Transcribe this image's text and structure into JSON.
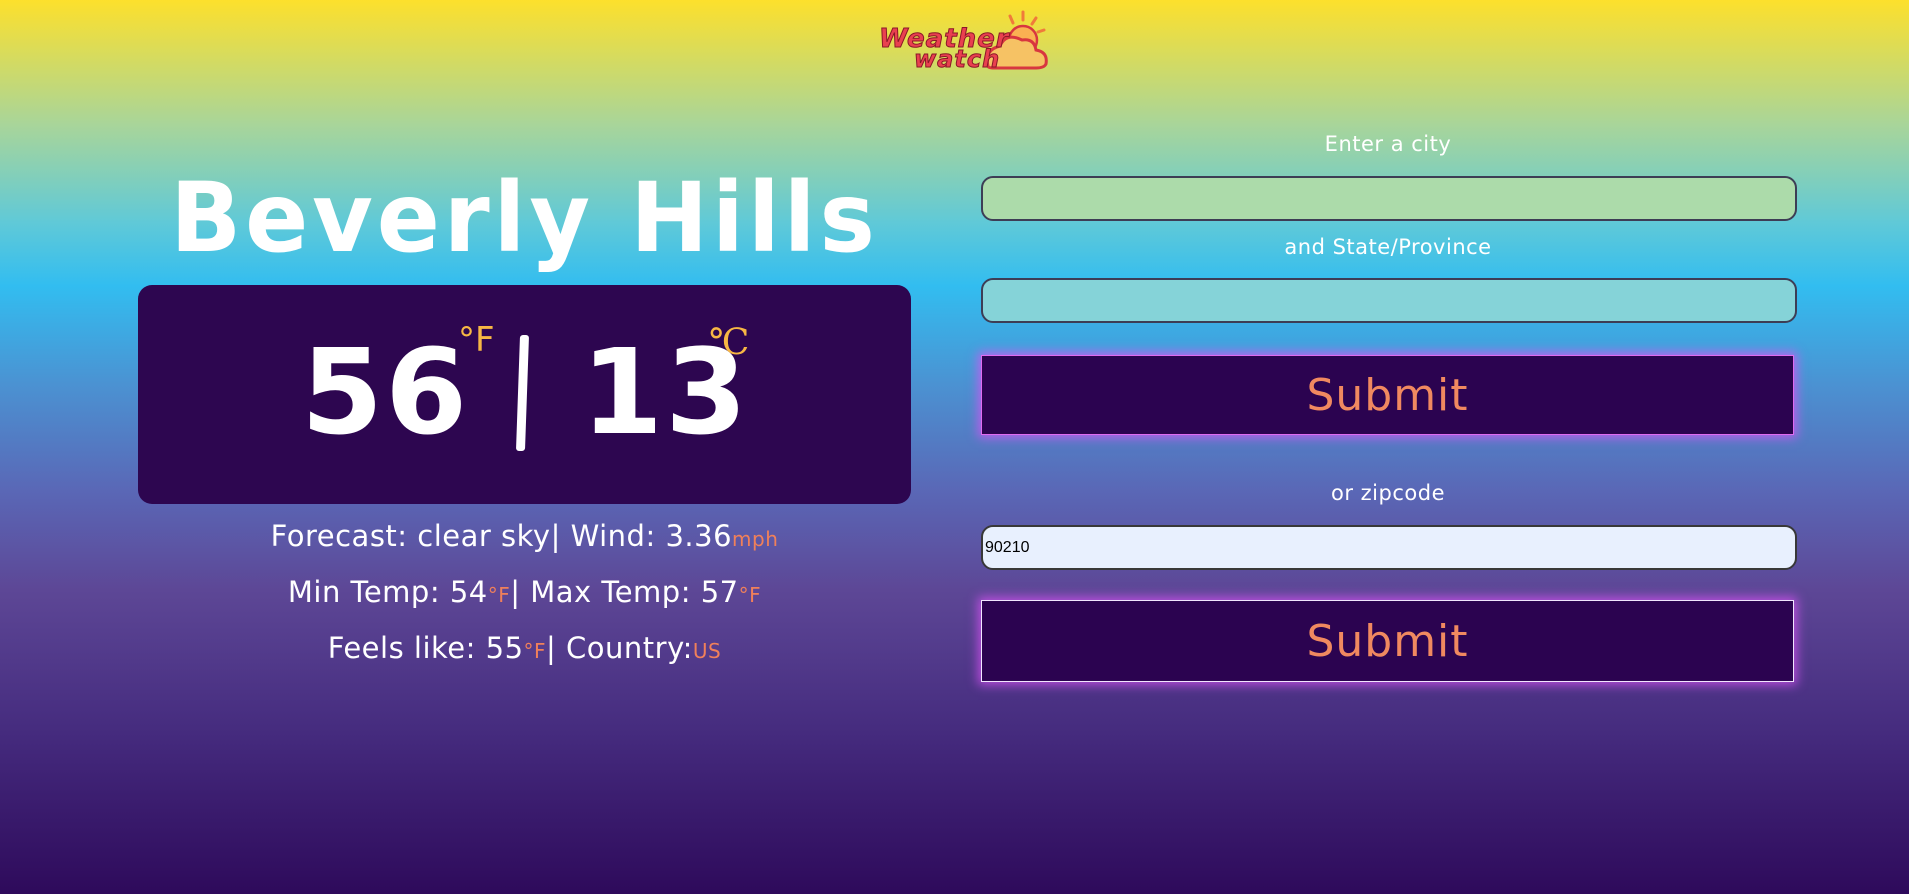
{
  "logo": {
    "line1": "Weather",
    "line2": "watch"
  },
  "weather": {
    "city": "Beverly Hills",
    "temp_f": "56",
    "unit_f": "°F",
    "divider": "|",
    "temp_c": "13",
    "unit_c": "℃",
    "forecast_label": "Forecast: ",
    "forecast_value": "clear sky",
    "wind_label": "| Wind: ",
    "wind_value": "3.36",
    "wind_unit": "mph",
    "min_label": "Min Temp: ",
    "min_value": "54",
    "min_unit": "°F",
    "max_label": "| Max Temp: ",
    "max_value": "57",
    "max_unit": "°F",
    "feels_label": "Feels like: ",
    "feels_value": "55",
    "feels_unit": "°F",
    "country_label": "| Country:",
    "country_value": "US"
  },
  "form": {
    "city_label": "Enter a city",
    "city_value": "",
    "state_label": "and State/Province",
    "state_value": "",
    "submit_label": "Submit",
    "zip_label": "or zipcode",
    "zip_value": "90210",
    "zip_submit_label": "Submit"
  },
  "colors": {
    "panel_bg": "#2d0650",
    "accent_orange": "#f08960",
    "unit_gold": "#f7b744",
    "glow_pink": "#d953f6"
  }
}
